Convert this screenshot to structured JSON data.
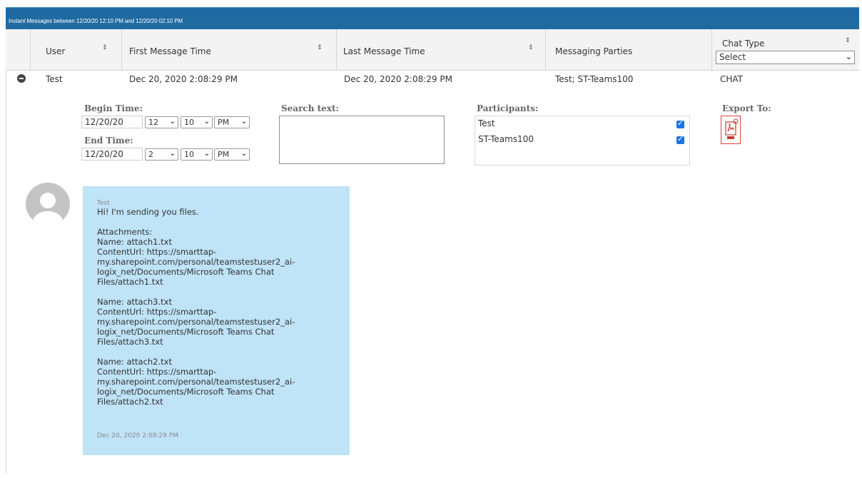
{
  "title": "Instant Messages between 12/20/20 12:10 PM and 12/20/20 02:10 PM",
  "columns": {
    "user": "User",
    "first_message_time": "First Message Time",
    "last_message_time": "Last Message Time",
    "messaging_parties": "Messaging Parties",
    "chat_type": "Chat Type",
    "chat_type_select": "Select"
  },
  "row": {
    "user": "Test",
    "first_message_time": "Dec 20, 2020 2:08:29 PM",
    "last_message_time": "Dec 20, 2020 2:08:29 PM",
    "messaging_parties": "Test; ST-Teams100",
    "chat_type": "CHAT"
  },
  "details": {
    "begin_time_label": "Begin Time:",
    "begin_date": "12/20/20",
    "begin_hour": "12",
    "begin_minute": "10",
    "begin_ampm": "PM",
    "end_time_label": "End Time:",
    "end_date": "12/20/20",
    "end_hour": "2",
    "end_minute": "10",
    "end_ampm": "PM",
    "search_label": "Search text:",
    "participants_label": "Participants:",
    "participants": [
      "Test",
      "ST-Teams100"
    ],
    "export_label": "Export To:"
  },
  "message": {
    "sender": "Test",
    "body": "Hi! I'm sending you files.\n\nAttachments:\nName: attach1.txt\nContentUrl: https://smarttap-\nmy.sharepoint.com/personal/teamstestuser2_ai-\nlogix_net/Documents/Microsoft Teams Chat\nFiles/attach1.txt\n\nName: attach3.txt\nContentUrl: https://smarttap-\nmy.sharepoint.com/personal/teamstestuser2_ai-\nlogix_net/Documents/Microsoft Teams Chat\nFiles/attach3.txt\n\nName: attach2.txt\nContentUrl: https://smarttap-\nmy.sharepoint.com/personal/teamstestuser2_ai-\nlogix_net/Documents/Microsoft Teams Chat\nFiles/attach2.txt",
    "timestamp": "Dec 20, 2020 2:08:29 PM"
  },
  "colors": {
    "titlebar": "#1f6aa1",
    "bubble": "#bfe3f7",
    "checkbox": "#1a73e8"
  }
}
